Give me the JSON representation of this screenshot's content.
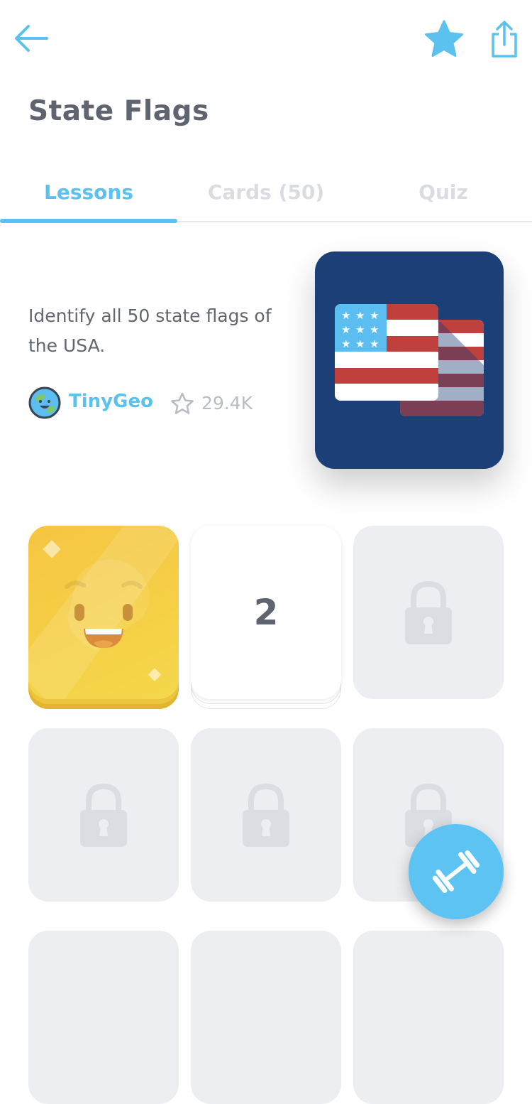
{
  "header": {
    "back_icon": "arrow-left-icon",
    "favorite_icon": "star-icon",
    "share_icon": "share-icon",
    "accent_color": "#5bc2ef"
  },
  "title": "State Flags",
  "tabs": [
    {
      "label": "Lessons",
      "active": true
    },
    {
      "label": "Cards (50)",
      "active": false
    },
    {
      "label": "Quiz",
      "active": false
    }
  ],
  "description": "Identify all 50 state flags of the USA.",
  "author": {
    "name": "TinyGeo",
    "avatar_icon": "globe-avatar-icon"
  },
  "rating": {
    "icon": "star-outline-icon",
    "count": "29.4K"
  },
  "course_card": {
    "icon": "us-flags-icon",
    "background": "#1c3f78"
  },
  "lessons": [
    {
      "state": "completed",
      "icon": "smiley-face-icon",
      "color": "#f5cf45"
    },
    {
      "state": "current",
      "number": "2"
    },
    {
      "state": "locked",
      "icon": "lock-icon"
    },
    {
      "state": "locked",
      "icon": "lock-icon"
    },
    {
      "state": "locked",
      "icon": "lock-icon"
    },
    {
      "state": "locked",
      "icon": "lock-icon"
    },
    {
      "state": "locked",
      "icon": "lock-icon"
    },
    {
      "state": "locked",
      "icon": "lock-icon"
    },
    {
      "state": "locked",
      "icon": "lock-icon"
    }
  ],
  "fab": {
    "icon": "dumbbell-icon",
    "color": "#5cc3f2"
  }
}
